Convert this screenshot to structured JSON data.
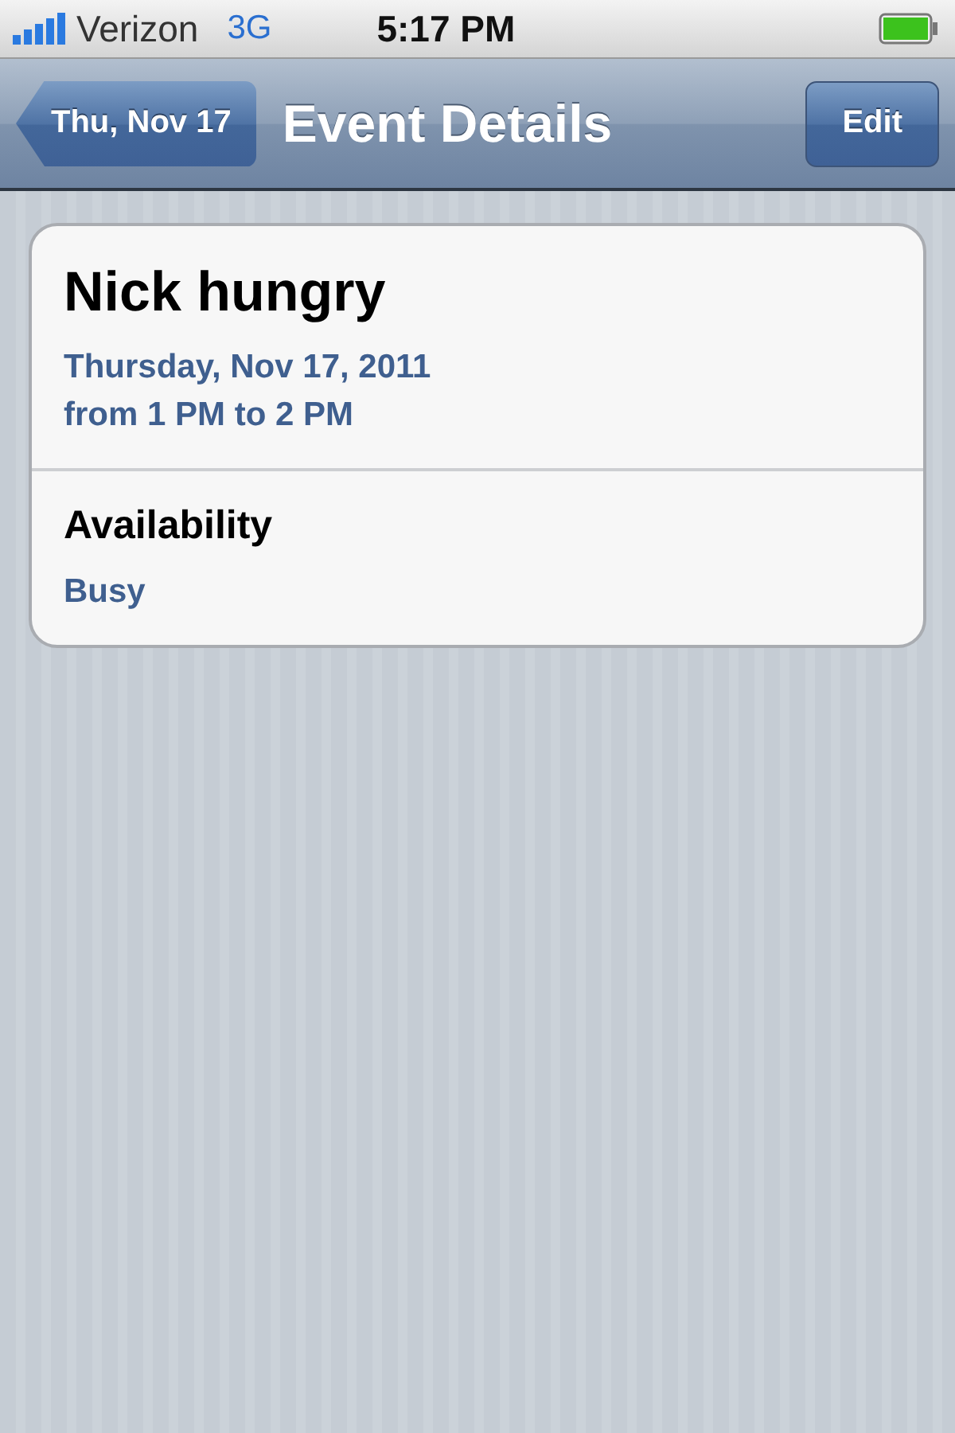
{
  "status_bar": {
    "carrier": "Verizon",
    "network": "3G",
    "time": "5:17 PM"
  },
  "nav_bar": {
    "back": "Thu, Nov 17",
    "title": "Event Details",
    "action": "Edit"
  },
  "event": {
    "title": "Nick hungry",
    "date": "Thursday, Nov 17, 2011",
    "time": "from 1 PM to 2 PM"
  },
  "sections": [
    {
      "label": "Availability",
      "value": "Busy"
    }
  ]
}
